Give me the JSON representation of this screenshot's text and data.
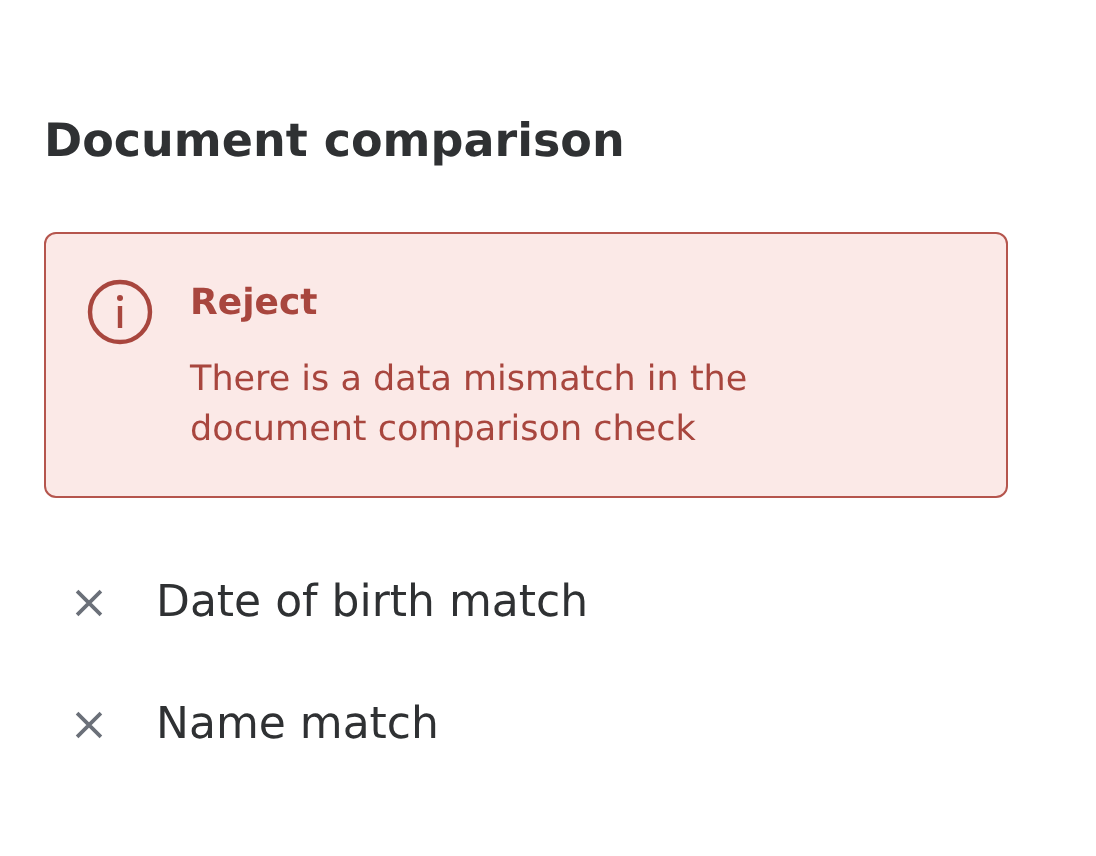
{
  "title": "Document comparison",
  "alert": {
    "kind": "error",
    "title": "Reject",
    "message": "There is a data mismatch in the document comparison check"
  },
  "checks": [
    {
      "label": "Date of birth match",
      "passed": false
    },
    {
      "label": "Name match",
      "passed": false
    }
  ]
}
